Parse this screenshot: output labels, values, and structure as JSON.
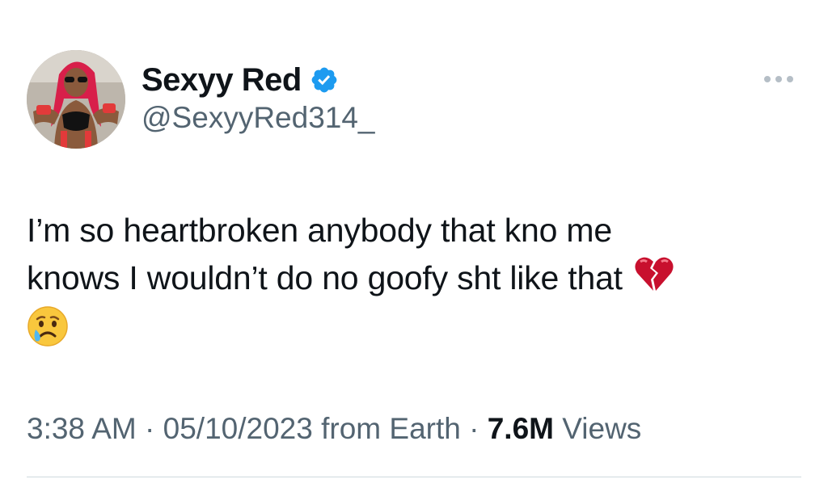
{
  "author": {
    "display_name": "Sexyy Red",
    "handle": "@SexyyRed314_",
    "verified": true,
    "avatar_icon": "profile-photo",
    "verified_color": "#1d9bf0"
  },
  "tweet": {
    "line1": "I’m so heartbroken anybody that kno me",
    "line2": "knows I wouldn’t do no goofy sht like that",
    "emoji_broken_heart": "broken-heart-emoji",
    "emoji_crying_face": "crying-face-emoji"
  },
  "meta": {
    "time": "3:38 AM",
    "separator": " · ",
    "date": "05/10/2023",
    "source": " from Earth",
    "views_count": "7.6M",
    "views_label": " Views"
  },
  "colors": {
    "text": "#0f1419",
    "secondary": "#536471",
    "divider": "#cfd9de",
    "more_dots": "#b5bec6"
  }
}
